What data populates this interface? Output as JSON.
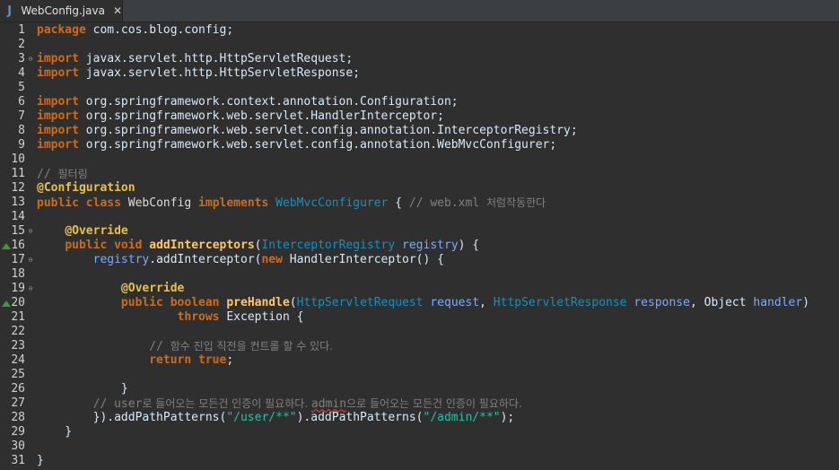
{
  "tab": {
    "icon": "java-file-icon",
    "icon_glyph": "J",
    "label": "WebConfig.java",
    "close_glyph": "✕"
  },
  "lines": [
    {
      "n": "1",
      "tokens": [
        [
          "kw",
          "package"
        ],
        [
          "plain",
          " com.cos.blog.config;"
        ]
      ]
    },
    {
      "n": "2",
      "tokens": []
    },
    {
      "n": "3",
      "fold": "collapse",
      "tokens": [
        [
          "kw",
          "import"
        ],
        [
          "plain",
          " javax.servlet.http.HttpServletRequest;"
        ]
      ]
    },
    {
      "n": "4",
      "tokens": [
        [
          "kw",
          "import"
        ],
        [
          "plain",
          " javax.servlet.http.HttpServletResponse;"
        ]
      ]
    },
    {
      "n": "5",
      "tokens": []
    },
    {
      "n": "6",
      "tokens": [
        [
          "kw",
          "import"
        ],
        [
          "plain",
          " org.springframework.context.annotation.Configuration;"
        ]
      ]
    },
    {
      "n": "7",
      "tokens": [
        [
          "kw",
          "import"
        ],
        [
          "plain",
          " org.springframework.web.servlet.HandlerInterceptor;"
        ]
      ]
    },
    {
      "n": "8",
      "tokens": [
        [
          "kw",
          "import"
        ],
        [
          "plain",
          " org.springframework.web.servlet.config.annotation.InterceptorRegistry;"
        ]
      ]
    },
    {
      "n": "9",
      "tokens": [
        [
          "kw",
          "import"
        ],
        [
          "plain",
          " org.springframework.web.servlet.config.annotation.WebMvcConfigurer;"
        ]
      ]
    },
    {
      "n": "10",
      "tokens": []
    },
    {
      "n": "11",
      "tokens": [
        [
          "cmt",
          "// "
        ],
        [
          "cmt kor",
          "필터링"
        ]
      ]
    },
    {
      "n": "12",
      "tokens": [
        [
          "ann-name",
          "@Configuration"
        ]
      ]
    },
    {
      "n": "13",
      "tokens": [
        [
          "kw",
          "public"
        ],
        [
          "plain",
          " "
        ],
        [
          "kw",
          "class"
        ],
        [
          "plain",
          " "
        ],
        [
          "cls",
          "WebConfig"
        ],
        [
          "plain",
          " "
        ],
        [
          "kw",
          "implements"
        ],
        [
          "plain",
          " "
        ],
        [
          "type",
          "WebMvcConfigurer"
        ],
        [
          "plain",
          " { "
        ],
        [
          "cmt",
          "// web.xml "
        ],
        [
          "cmt kor",
          "처럼작동한다"
        ]
      ]
    },
    {
      "n": "14",
      "tokens": []
    },
    {
      "n": "15",
      "fold": "collapse",
      "tokens": [
        [
          "plain",
          "    "
        ],
        [
          "ann-name",
          "@Override"
        ]
      ]
    },
    {
      "n": "16",
      "override": true,
      "tokens": [
        [
          "plain",
          "    "
        ],
        [
          "kw",
          "public"
        ],
        [
          "plain",
          " "
        ],
        [
          "kw",
          "void"
        ],
        [
          "plain",
          " "
        ],
        [
          "meth",
          "addInterceptors"
        ],
        [
          "plain",
          "("
        ],
        [
          "type",
          "InterceptorRegistry"
        ],
        [
          "plain",
          " "
        ],
        [
          "param",
          "registry"
        ],
        [
          "plain",
          ") {"
        ]
      ]
    },
    {
      "n": "17",
      "fold": "collapse",
      "tokens": [
        [
          "plain",
          "        "
        ],
        [
          "param",
          "registry"
        ],
        [
          "plain",
          ".addInterceptor("
        ],
        [
          "kw",
          "new"
        ],
        [
          "plain",
          " HandlerInterceptor() {"
        ]
      ]
    },
    {
      "n": "18",
      "tokens": []
    },
    {
      "n": "19",
      "fold": "collapse",
      "tokens": [
        [
          "plain",
          "            "
        ],
        [
          "ann-name",
          "@Override"
        ]
      ]
    },
    {
      "n": "20",
      "override": true,
      "tokens": [
        [
          "plain",
          "            "
        ],
        [
          "kw",
          "public"
        ],
        [
          "plain",
          " "
        ],
        [
          "kw",
          "boolean"
        ],
        [
          "plain",
          " "
        ],
        [
          "meth",
          "preHandle"
        ],
        [
          "plain",
          "("
        ],
        [
          "type",
          "HttpServletRequest"
        ],
        [
          "plain",
          " "
        ],
        [
          "param",
          "request"
        ],
        [
          "plain",
          ", "
        ],
        [
          "type",
          "HttpServletResponse"
        ],
        [
          "plain",
          " "
        ],
        [
          "param",
          "response"
        ],
        [
          "plain",
          ", Object "
        ],
        [
          "param",
          "handler"
        ],
        [
          "plain",
          ")"
        ]
      ]
    },
    {
      "n": "21",
      "tokens": [
        [
          "plain",
          "                    "
        ],
        [
          "kw",
          "throws"
        ],
        [
          "plain",
          " Exception {"
        ]
      ]
    },
    {
      "n": "22",
      "tokens": []
    },
    {
      "n": "23",
      "tokens": [
        [
          "plain",
          "                "
        ],
        [
          "cmt",
          "// "
        ],
        [
          "cmt kor",
          "함수 진입 직전을 컨트롤 할 수 있다."
        ]
      ]
    },
    {
      "n": "24",
      "tokens": [
        [
          "plain",
          "                "
        ],
        [
          "kw",
          "return"
        ],
        [
          "plain",
          " "
        ],
        [
          "kw",
          "true"
        ],
        [
          "plain",
          ";"
        ]
      ]
    },
    {
      "n": "25",
      "tokens": []
    },
    {
      "n": "26",
      "tokens": [
        [
          "plain",
          "            }"
        ]
      ]
    },
    {
      "n": "27",
      "tokens": [
        [
          "plain",
          "        "
        ],
        [
          "cmt",
          "// user"
        ],
        [
          "cmt kor",
          "로 들어오는 모든건 인증이 필요하다. "
        ],
        [
          "cmt squig",
          "admin"
        ],
        [
          "cmt kor",
          "으로 들어오는 모든건 인증이 필요하다."
        ]
      ]
    },
    {
      "n": "28",
      "tokens": [
        [
          "plain",
          "        }).addPathPatterns("
        ],
        [
          "str",
          "\"/user/**\""
        ],
        [
          "plain",
          ").addPathPatterns("
        ],
        [
          "str",
          "\"/admin/**\""
        ],
        [
          "plain",
          ");"
        ]
      ]
    },
    {
      "n": "29",
      "tokens": [
        [
          "plain",
          "    }"
        ]
      ]
    },
    {
      "n": "30",
      "tokens": []
    },
    {
      "n": "31",
      "tokens": [
        [
          "plain",
          "}"
        ]
      ]
    }
  ],
  "colors": {
    "background": "#2f2f2f",
    "keyword": "#cc6c1d",
    "annotation": "#e8c04a",
    "type": "#1290c3",
    "method": "#ffc66d",
    "parameter": "#79abff",
    "string": "#17c6a3",
    "comment": "#808080",
    "override_marker": "#3c9a3c"
  }
}
